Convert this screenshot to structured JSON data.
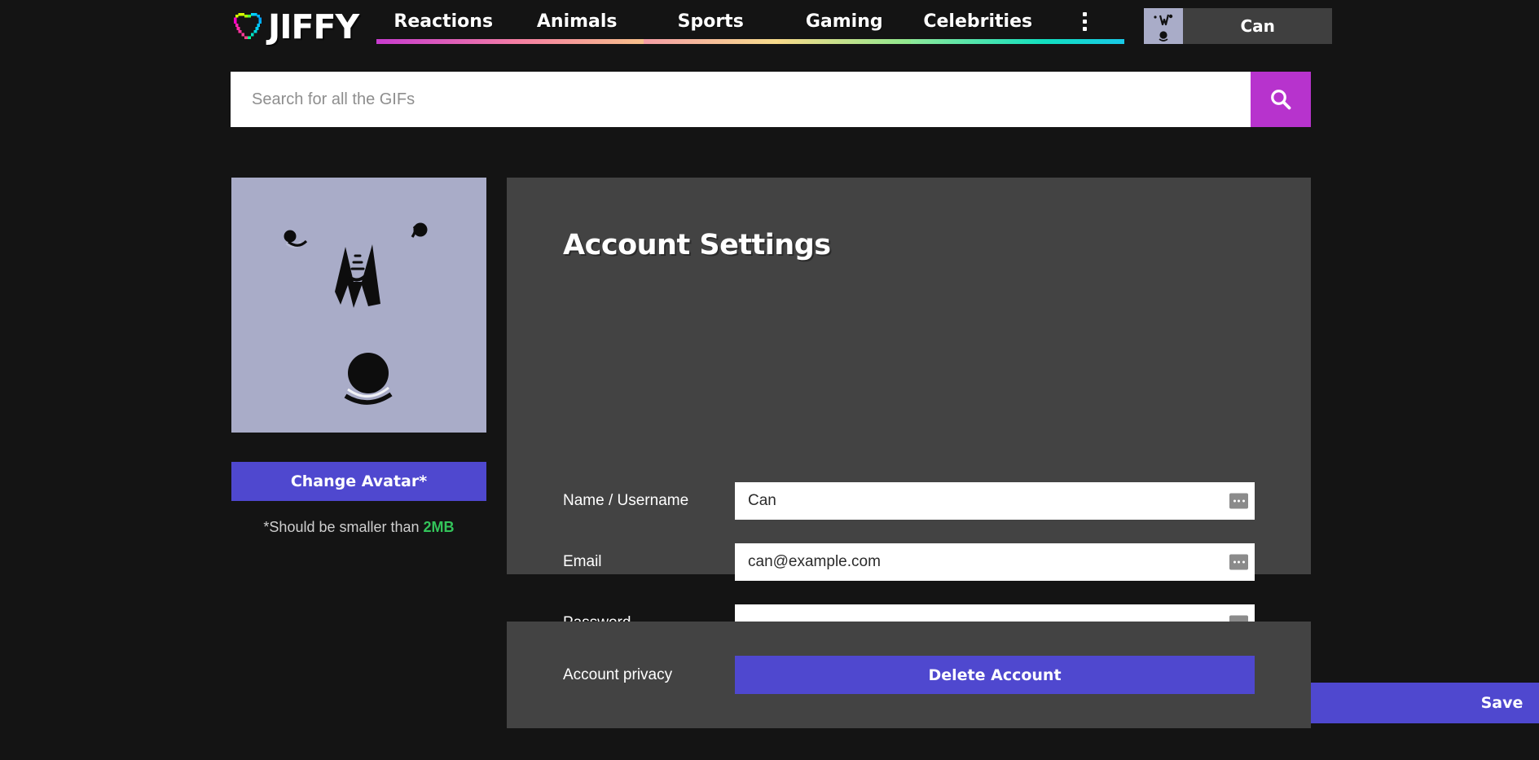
{
  "brand": {
    "name": "JIFFY",
    "logo_icon": "pixel-heart-icon",
    "logo_colors": [
      "#d4ff00",
      "#ff00c8",
      "#00c8ff",
      "#00ff95"
    ]
  },
  "nav": {
    "items": [
      {
        "label": "Reactions",
        "underline_from": "#c83ccf",
        "underline_to": "#f07aa8"
      },
      {
        "label": "Animals",
        "underline_from": "#f57ba4",
        "underline_to": "#f7c08b"
      },
      {
        "label": "Sports",
        "underline_from": "#f59ea6",
        "underline_to": "#f6dc8c"
      },
      {
        "label": "Gaming",
        "underline_from": "#f8d98a",
        "underline_to": "#8ee98f"
      },
      {
        "label": "Celebrities",
        "underline_from": "#8ee99a",
        "underline_to": "#12e0c0"
      }
    ],
    "more_icon": "more-vertical-icon",
    "more_underline_from": "#12e0c0",
    "more_underline_to": "#19c9e8"
  },
  "user": {
    "name": "Can",
    "avatar_icon": "user-avatar-icon"
  },
  "search": {
    "placeholder": "Search for all the GIFs",
    "value": "",
    "button_icon": "search-icon",
    "button_color": "#b733cd"
  },
  "avatar_panel": {
    "image_icon": "default-avatar-image",
    "change_button_label": "Change Avatar*",
    "note_prefix": "*Should be smaller than ",
    "note_highlight": "2MB",
    "highlight_color": "#33c45a"
  },
  "settings_panel": {
    "title": "Account Settings",
    "fields": [
      {
        "label": "Name / Username",
        "value": "Can",
        "type": "text",
        "autofill_icon": "autofill-dots-icon"
      },
      {
        "label": "Email",
        "value": "can@example.com",
        "type": "text",
        "autofill_icon": "autofill-dots-icon"
      },
      {
        "label": "Password",
        "value": "",
        "type": "password",
        "autofill_icon": "autofill-dots-icon"
      }
    ],
    "save_label": "Save",
    "accent_color": "#4f48cf"
  },
  "privacy_panel": {
    "label": "Account privacy",
    "delete_label": "Delete Account"
  },
  "theme": {
    "page_bg": "#141414",
    "panel_bg": "#434343",
    "accent": "#4f48cf",
    "search_accent": "#b733cd",
    "avatar_bg": "#a9acc8"
  }
}
